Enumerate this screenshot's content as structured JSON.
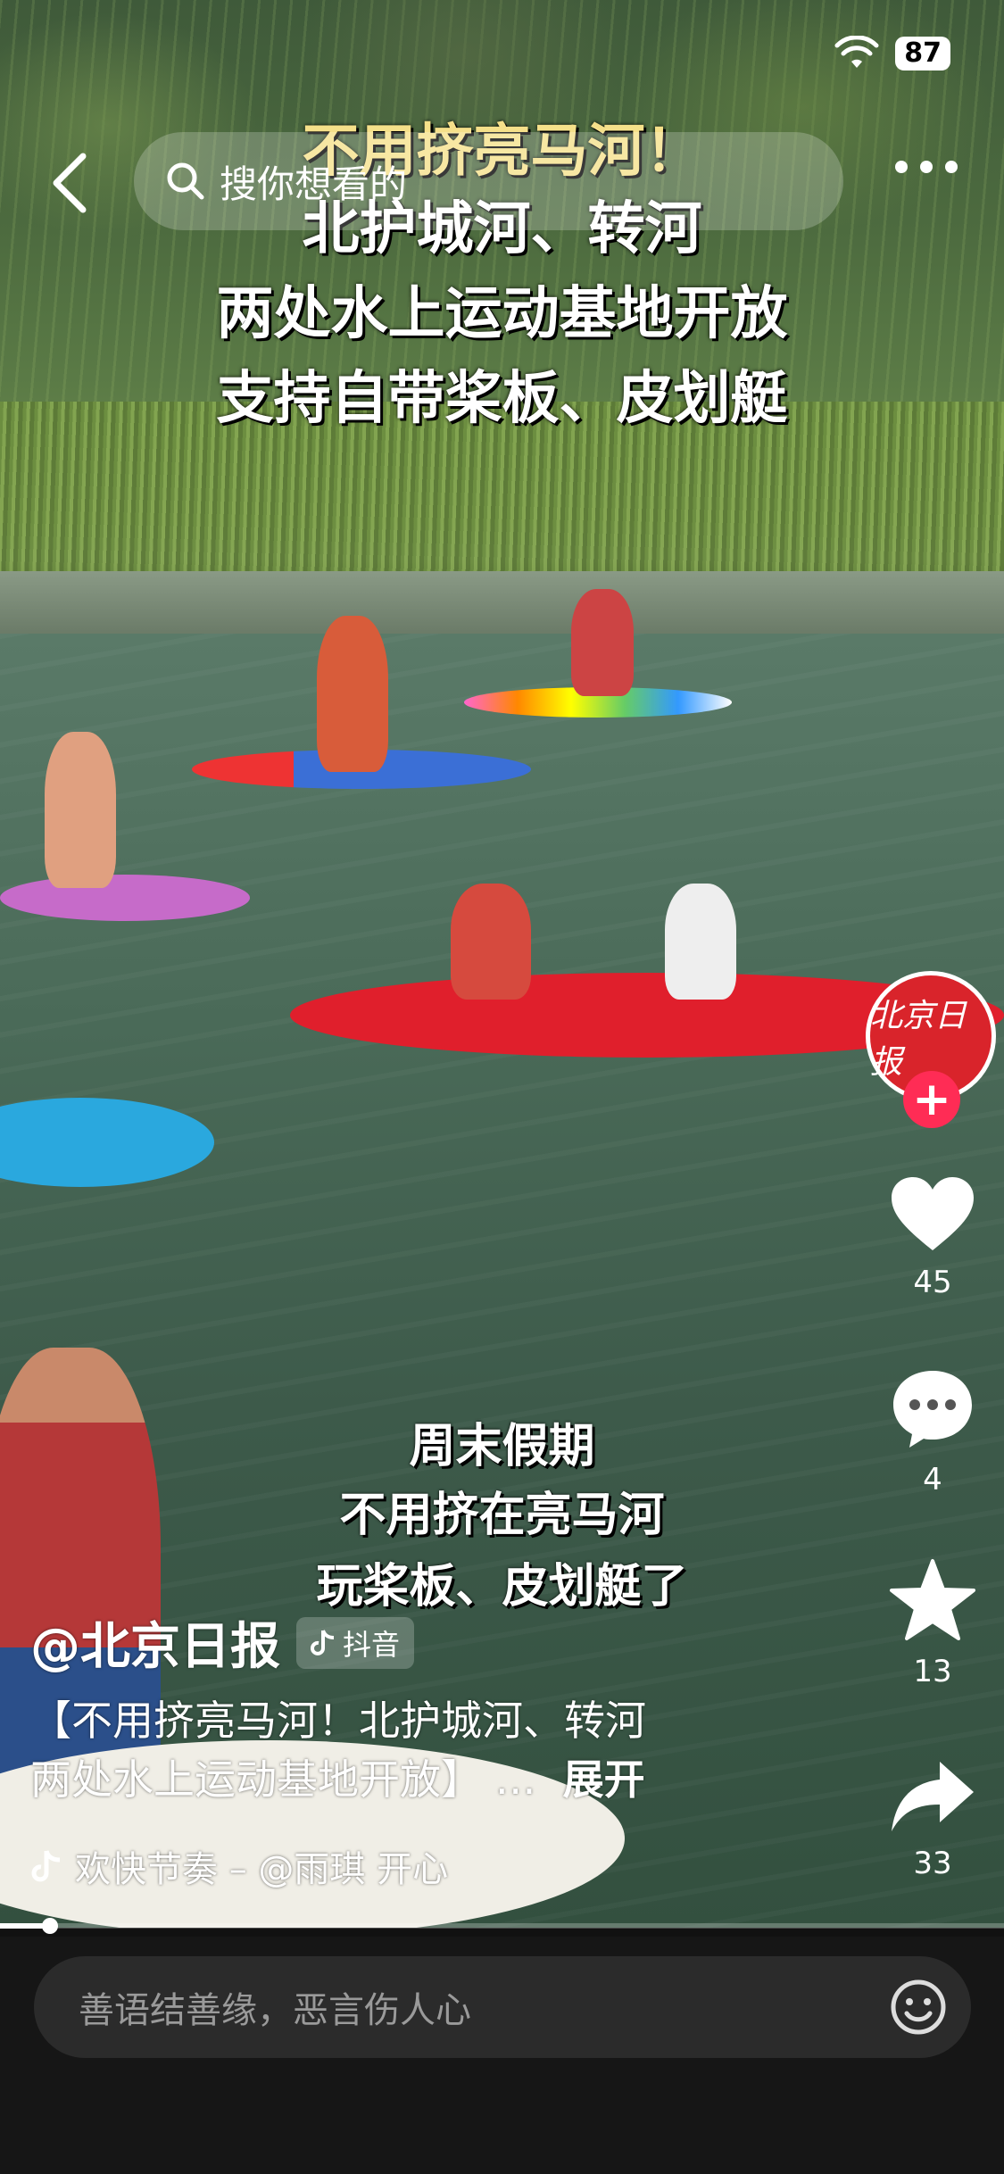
{
  "status_bar": {
    "battery": "87"
  },
  "top_bar": {
    "search_placeholder": "搜你想看的"
  },
  "video": {
    "title_lines": [
      "不用挤亮马河！",
      "北护城河、转河",
      "两处水上运动基地开放",
      "支持自带桨板、皮划艇"
    ],
    "subtitle_lines": [
      "周末假期",
      "不用挤在亮马河",
      "玩桨板、皮划艇了"
    ]
  },
  "actions": {
    "avatar_text": "北京日报",
    "follow_symbol": "+",
    "likes": "45",
    "comments": "4",
    "favorites": "13",
    "shares": "33"
  },
  "post": {
    "author": "@北京日报",
    "source_tag": "抖音",
    "description_line1": "【不用挤亮马河！北护城河、转河",
    "description_line2": "两处水上运动基地开放】 …",
    "expand_label": "展开",
    "music": "欢快节奏  – @雨琪    开心"
  },
  "progress": {
    "fraction": 0.05
  },
  "comment_bar": {
    "placeholder": "善语结善缘，恶言伤人心"
  },
  "colors": {
    "accent": "#ff2c55",
    "avatar_bg": "#d9242b"
  },
  "icons": [
    "back-chevron-icon",
    "search-icon",
    "more-icon",
    "heart-icon",
    "comment-icon",
    "star-icon",
    "share-icon",
    "music-note-icon",
    "emoji-icon",
    "wifi-icon"
  ]
}
